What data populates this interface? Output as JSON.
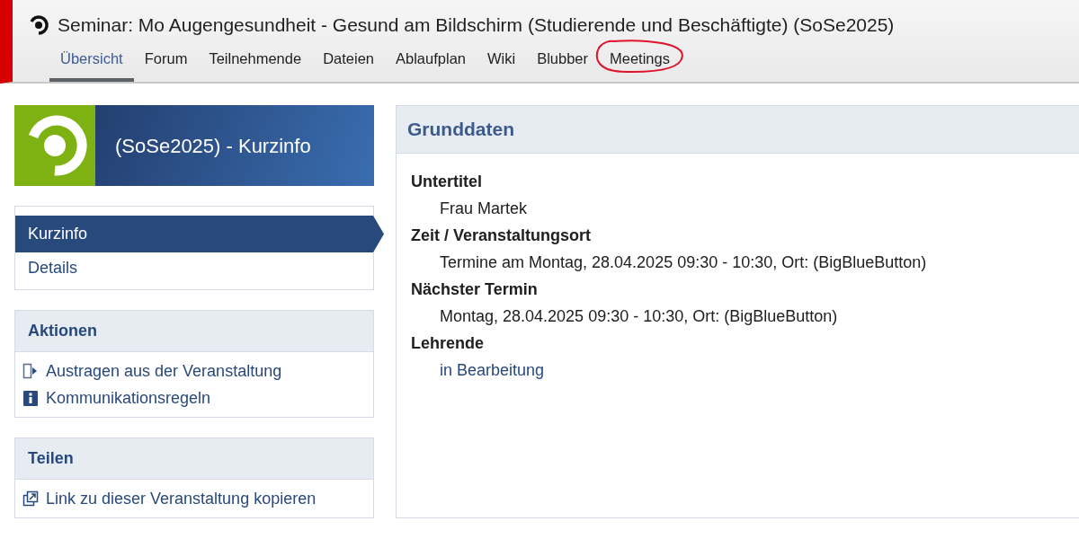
{
  "header": {
    "title": "Seminar: Mo Augengesundheit - Gesund am Bildschirm (Studierende und Beschäftigte) (SoSe2025)"
  },
  "tabs": [
    {
      "label": "Übersicht",
      "selected": true,
      "circled": false
    },
    {
      "label": "Forum",
      "selected": false,
      "circled": false
    },
    {
      "label": "Teilnehmende",
      "selected": false,
      "circled": false
    },
    {
      "label": "Dateien",
      "selected": false,
      "circled": false
    },
    {
      "label": "Ablaufplan",
      "selected": false,
      "circled": false
    },
    {
      "label": "Wiki",
      "selected": false,
      "circled": false
    },
    {
      "label": "Blubber",
      "selected": false,
      "circled": false
    },
    {
      "label": "Meetings",
      "selected": false,
      "circled": true
    }
  ],
  "banner": {
    "title": "(SoSe2025) - Kurzinfo"
  },
  "sidebar": {
    "nav": [
      {
        "label": "Kurzinfo",
        "selected": true
      },
      {
        "label": "Details",
        "selected": false
      }
    ],
    "sections": [
      {
        "title": "Aktionen",
        "items": [
          {
            "label": "Austragen aus der Veranstaltung",
            "kind": "leave"
          },
          {
            "label": "Kommunikationsregeln",
            "kind": "info"
          }
        ]
      },
      {
        "title": "Teilen",
        "items": [
          {
            "label": "Link zu dieser Veranstaltung kopieren",
            "kind": "copy"
          }
        ]
      }
    ]
  },
  "panel": {
    "title": "Grunddaten",
    "fields": [
      {
        "label": "Untertitel",
        "value": "Frau Martek",
        "link": false
      },
      {
        "label": "Zeit / Veranstaltungsort",
        "value": "Termine am Montag, 28.04.2025 09:30 - 10:30, Ort: (BigBlueButton)",
        "link": false
      },
      {
        "label": "Nächster Termin",
        "value": "Montag, 28.04.2025 09:30 - 10:30, Ort: (BigBlueButton)",
        "link": false
      },
      {
        "label": "Lehrende",
        "value": "in Bearbeitung",
        "link": true
      }
    ]
  }
}
